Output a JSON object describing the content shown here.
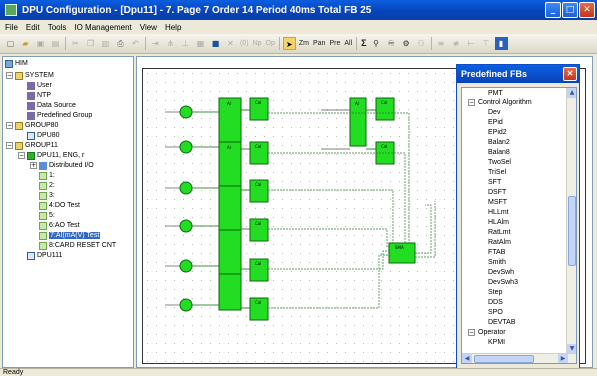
{
  "window": {
    "title": "DPU Configuration - [Dpu11] - 7. Page 7 Order 14  Period 40ms  Total FB 25",
    "min": "_",
    "max": "□",
    "close": "✕"
  },
  "menu": [
    "File",
    "Edit",
    "Tools",
    "IO Management",
    "View",
    "Help"
  ],
  "toolbar": {
    "icons": [
      "new-icon",
      "open-icon",
      "save-icon",
      "print-preview-icon",
      "cut-icon",
      "copy-icon",
      "paste-icon",
      "print-icon",
      "undo-icon",
      "insert-icon",
      "delete-icon",
      "compile-icon",
      "save-all-icon",
      "cross-icon",
      "fb-icon"
    ],
    "labels": {
      "np": "Np",
      "op": "Op",
      "zm": "Zm",
      "pan": "Pan",
      "pre": "Pre",
      "all": "All",
      "sigma": "Σ"
    }
  },
  "tree": {
    "items": [
      {
        "label": "HIM",
        "level": 0
      },
      {
        "label": "SYSTEM",
        "level": 1
      },
      {
        "label": "User",
        "level": 2
      },
      {
        "label": "NTP",
        "level": 2
      },
      {
        "label": "Data Source",
        "level": 2
      },
      {
        "label": "Predefined Group",
        "level": 2
      },
      {
        "label": "GROUP80",
        "level": 1
      },
      {
        "label": "DPU80",
        "level": 2
      },
      {
        "label": "GROUP11",
        "level": 1
      },
      {
        "label": "DPU11, ENG, r",
        "level": 2
      },
      {
        "label": "Distributed I/O",
        "level": 3
      },
      {
        "label": "1:",
        "level": 4
      },
      {
        "label": "2:",
        "level": 4
      },
      {
        "label": "3:",
        "level": 4
      },
      {
        "label": "4:DO Test",
        "level": 4
      },
      {
        "label": "5:",
        "level": 4
      },
      {
        "label": "6:AO Test",
        "level": 4
      },
      {
        "label": "7:AI(mA(V) Test",
        "level": 4,
        "selected": true
      },
      {
        "label": "8:CARD RESET CNT",
        "level": 4
      },
      {
        "label": "DPU111",
        "level": 2
      }
    ]
  },
  "palette": {
    "title": "Predefined FBs",
    "items": [
      {
        "label": "PMT",
        "indent": 2
      },
      {
        "label": "Control Algorithm",
        "indent": 1,
        "group": true
      },
      {
        "label": "Dev",
        "indent": 2
      },
      {
        "label": "EPid",
        "indent": 2
      },
      {
        "label": "EPid2",
        "indent": 2
      },
      {
        "label": "Balan2",
        "indent": 2
      },
      {
        "label": "Balan8",
        "indent": 2
      },
      {
        "label": "TwoSel",
        "indent": 2
      },
      {
        "label": "TriSel",
        "indent": 2
      },
      {
        "label": "SFT",
        "indent": 2
      },
      {
        "label": "DSFT",
        "indent": 2
      },
      {
        "label": "MSFT",
        "indent": 2
      },
      {
        "label": "HLLmt",
        "indent": 2
      },
      {
        "label": "HLAlm",
        "indent": 2
      },
      {
        "label": "RatLmt",
        "indent": 2
      },
      {
        "label": "RatAlm",
        "indent": 2
      },
      {
        "label": "FTAB",
        "indent": 2
      },
      {
        "label": "Smith",
        "indent": 2
      },
      {
        "label": "DevSwh",
        "indent": 2
      },
      {
        "label": "DevSwh3",
        "indent": 2
      },
      {
        "label": "Step",
        "indent": 2
      },
      {
        "label": "DDS",
        "indent": 2
      },
      {
        "label": "SPO",
        "indent": 2
      },
      {
        "label": "DEVTAB",
        "indent": 2
      },
      {
        "label": "Operator",
        "indent": 1,
        "group": true
      },
      {
        "label": "KPMI",
        "indent": 2
      }
    ]
  },
  "diagram": {
    "block_labels": {
      "ai": "AI",
      "cal": "Cal",
      "sma": "SMA"
    }
  },
  "status": {
    "text": "Ready"
  },
  "colors": {
    "titlebar": "#0a5fe0",
    "fb_fill": "#22dd22",
    "fb_stroke": "#0a6a0a",
    "selection": "#316ac5"
  }
}
